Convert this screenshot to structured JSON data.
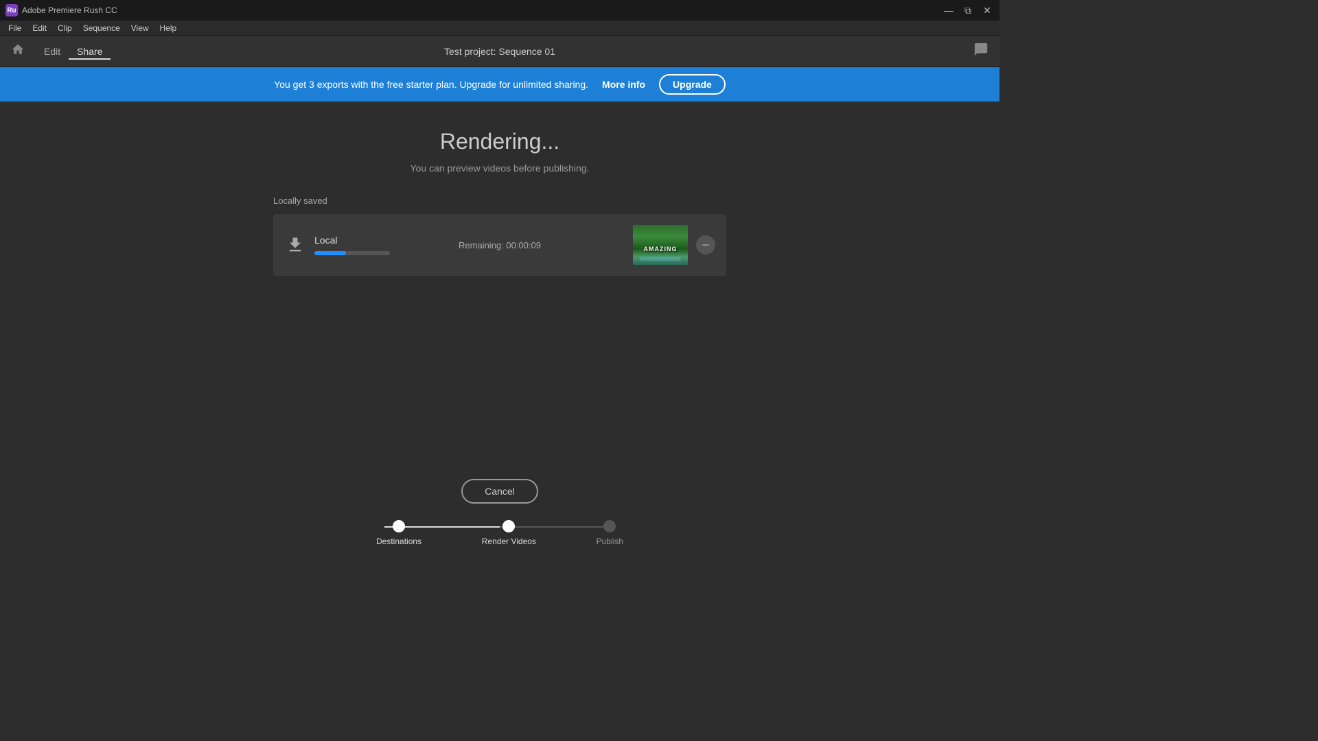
{
  "titleBar": {
    "appIcon": "Ru",
    "appTitle": "Adobe Premiere Rush CC"
  },
  "menuBar": {
    "items": [
      "File",
      "Edit",
      "Clip",
      "Sequence",
      "View",
      "Help"
    ]
  },
  "topNav": {
    "homeIcon": "⌂",
    "editLabel": "Edit",
    "shareLabel": "Share",
    "projectTitle": "Test project: Sequence 01",
    "chatIcon": "💬"
  },
  "banner": {
    "message": "You get 3 exports with the free starter plan. Upgrade for unlimited sharing.",
    "moreInfoLabel": "More info",
    "upgradeLabel": "Upgrade"
  },
  "main": {
    "renderingTitle": "Rendering...",
    "renderingSubtitle": "You can preview videos before publishing.",
    "locallySavedLabel": "Locally saved",
    "renderCard": {
      "localLabel": "Local",
      "remainingText": "Remaining: 00:00:09",
      "progressPercent": 42,
      "videoThumbnailText": "AMAZING",
      "removeIcon": "−"
    }
  },
  "bottomArea": {
    "cancelLabel": "Cancel",
    "steps": [
      {
        "label": "Destinations",
        "state": "completed"
      },
      {
        "label": "Render Videos",
        "state": "active"
      },
      {
        "label": "Publish",
        "state": "inactive"
      }
    ]
  },
  "windowControls": {
    "minimize": "—",
    "restore": "⧉",
    "close": "✕"
  }
}
